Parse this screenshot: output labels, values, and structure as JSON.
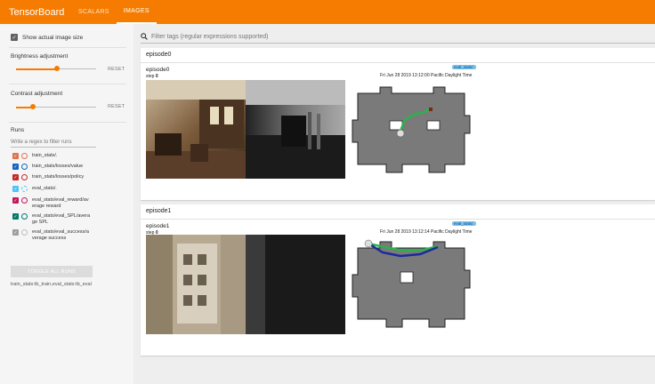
{
  "header": {
    "brand": "TensorBoard",
    "tabs": [
      {
        "label": "SCALARS",
        "active": false
      },
      {
        "label": "IMAGES",
        "active": true
      }
    ],
    "accent": "#f57c00"
  },
  "sidebar": {
    "show_actual_size": {
      "label": "Show actual image size",
      "checked": true
    },
    "brightness": {
      "label": "Brightness adjustment",
      "value": 0.5,
      "reset": "RESET"
    },
    "contrast": {
      "label": "Contrast adjustment",
      "value": 0.25,
      "reset": "RESET"
    },
    "runs_title": "Runs",
    "regex_placeholder": "Write a regex to filter runs",
    "runs": [
      {
        "label": "train_stats/.",
        "color": "#e0734e"
      },
      {
        "label": "train_stats/losses/value",
        "color": "#1565c0"
      },
      {
        "label": "train_stats/losses/policy",
        "color": "#c62828"
      },
      {
        "label": "eval_stats/.",
        "color": "#4fc3f7"
      },
      {
        "label": "eval_stats/eval_reward/av\nerage reward",
        "color": "#c2185b"
      },
      {
        "label": "eval_stats/eval_SPL/avera\nge SPL",
        "color": "#00796b"
      },
      {
        "label": "eval_stats/eval_success/a\nverage success",
        "color": "#9e9e9e"
      }
    ],
    "toggle_all": "TOGGLE ALL RUNS",
    "footer": "train_stats:tb_train,eval_stats:tb_eval"
  },
  "main": {
    "filter_placeholder": "Filter tags (regular expressions supported)",
    "cards": [
      {
        "title": "episode0",
        "image": {
          "name": "episode0",
          "step_label": "step",
          "step_value": "0",
          "badge": "eval_stats/.",
          "time": "Fri Jun 28 2019 13:12:00 Pacific Daylight Time"
        }
      },
      {
        "title": "episode1",
        "image": {
          "name": "episode1",
          "step_label": "step",
          "step_value": "0",
          "badge": "eval_stats/.",
          "time": "Fri Jun 28 2019 13:12:14 Pacific Daylight Time"
        }
      }
    ]
  }
}
